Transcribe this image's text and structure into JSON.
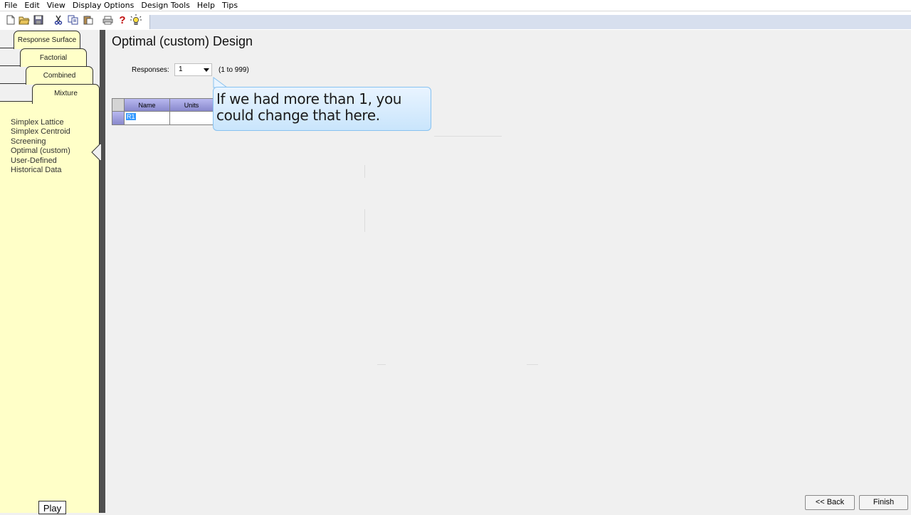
{
  "menu": [
    "File",
    "Edit",
    "View",
    "Display Options",
    "Design Tools",
    "Help",
    "Tips"
  ],
  "toolbar": {
    "icons": [
      "new-file-icon",
      "open-folder-icon",
      "save-icon",
      "cut-icon",
      "copy-icon",
      "paste-icon",
      "print-icon",
      "help-icon",
      "tip-lightbulb-icon"
    ],
    "help_glyph": "?"
  },
  "sidebar": {
    "tabs": [
      "Response Surface",
      "Factorial",
      "Combined",
      "Mixture"
    ],
    "active_tab": "Mixture",
    "designs": [
      "Simplex Lattice",
      "Simplex Centroid",
      "Screening",
      "Optimal (custom)",
      "User-Defined",
      "Historical Data"
    ],
    "selected_design": "Optimal (custom)",
    "play_label": "Play"
  },
  "main": {
    "title": "Optimal (custom) Design",
    "responses_label": "Responses:",
    "responses_value": "1",
    "responses_range": "(1 to 999)",
    "grid": {
      "columns": [
        "Name",
        "Units"
      ],
      "rows": [
        {
          "name": "R1",
          "units": ""
        }
      ]
    }
  },
  "callout": {
    "line1": "If we had more than 1, you",
    "line2": "could change that here."
  },
  "buttons": {
    "back": "<< Back",
    "finish": "Finish"
  },
  "colors": {
    "tab_fill": "#ffffc8",
    "header_fill": "#a0a0e0",
    "callout_fill": "#d8ecfd",
    "callout_border": "#88c2f0",
    "selection": "#3399ff"
  }
}
